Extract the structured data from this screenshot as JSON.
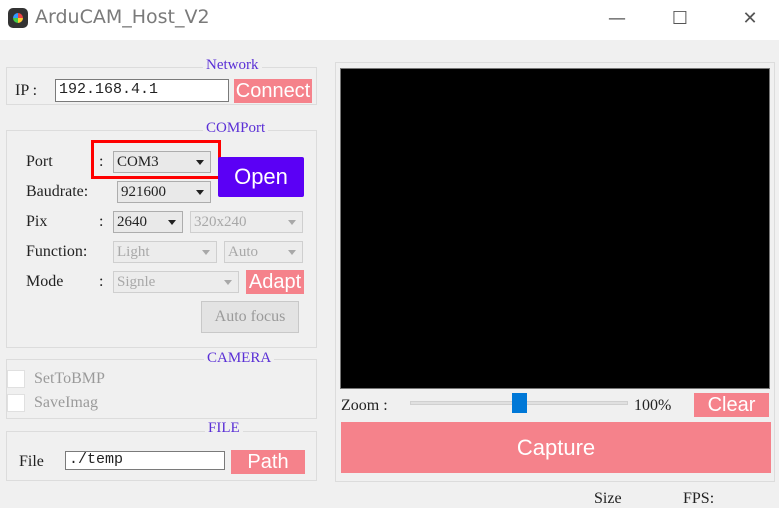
{
  "window": {
    "title": "ArduCAM_Host_V2",
    "icon": "arducam-app-icon",
    "minimize_glyph": "—",
    "maximize_glyph": "☐",
    "close_glyph": "✕"
  },
  "network": {
    "group_title": "Network",
    "ip_label": "IP :",
    "ip_value": "192.168.4.1",
    "connect_label": "Connect"
  },
  "comport": {
    "group_title": "COMPort",
    "port_label": "Port",
    "port_colon": ":",
    "port_value": "COM3",
    "open_label": "Open",
    "baudrate_label": "Baudrate:",
    "baudrate_value": "921600",
    "pix_label": "Pix",
    "pix_colon": ":",
    "pix_value": "2640",
    "resolution_value": "320x240",
    "function_label": "Function:",
    "function_value": "Light",
    "function_mode_value": "Auto",
    "mode_label": "Mode",
    "mode_colon": ":",
    "mode_value": "Signle",
    "adapt_label": "Adapt",
    "autofocus_label": "Auto focus"
  },
  "camera": {
    "group_title": "CAMERA",
    "set_to_bmp_label": "SetToBMP",
    "save_imag_label": "SaveImag"
  },
  "file": {
    "group_title": "FILE",
    "file_label": "File",
    "path_value": "./temp",
    "path_button_label": "Path"
  },
  "preview": {
    "zoom_label": "Zoom :",
    "zoom_value": "100%",
    "zoom_level_fraction": 0.5,
    "clear_label": "Clear",
    "capture_label": "Capture"
  },
  "status": {
    "size_label": "Size",
    "fps_label": "FPS:"
  },
  "colors": {
    "accent_pink": "#f5828b",
    "accent_purple": "#5b00f5",
    "group_title": "#5a2fd6",
    "highlight_red": "#ff0000",
    "slider_thumb": "#0078d7"
  }
}
